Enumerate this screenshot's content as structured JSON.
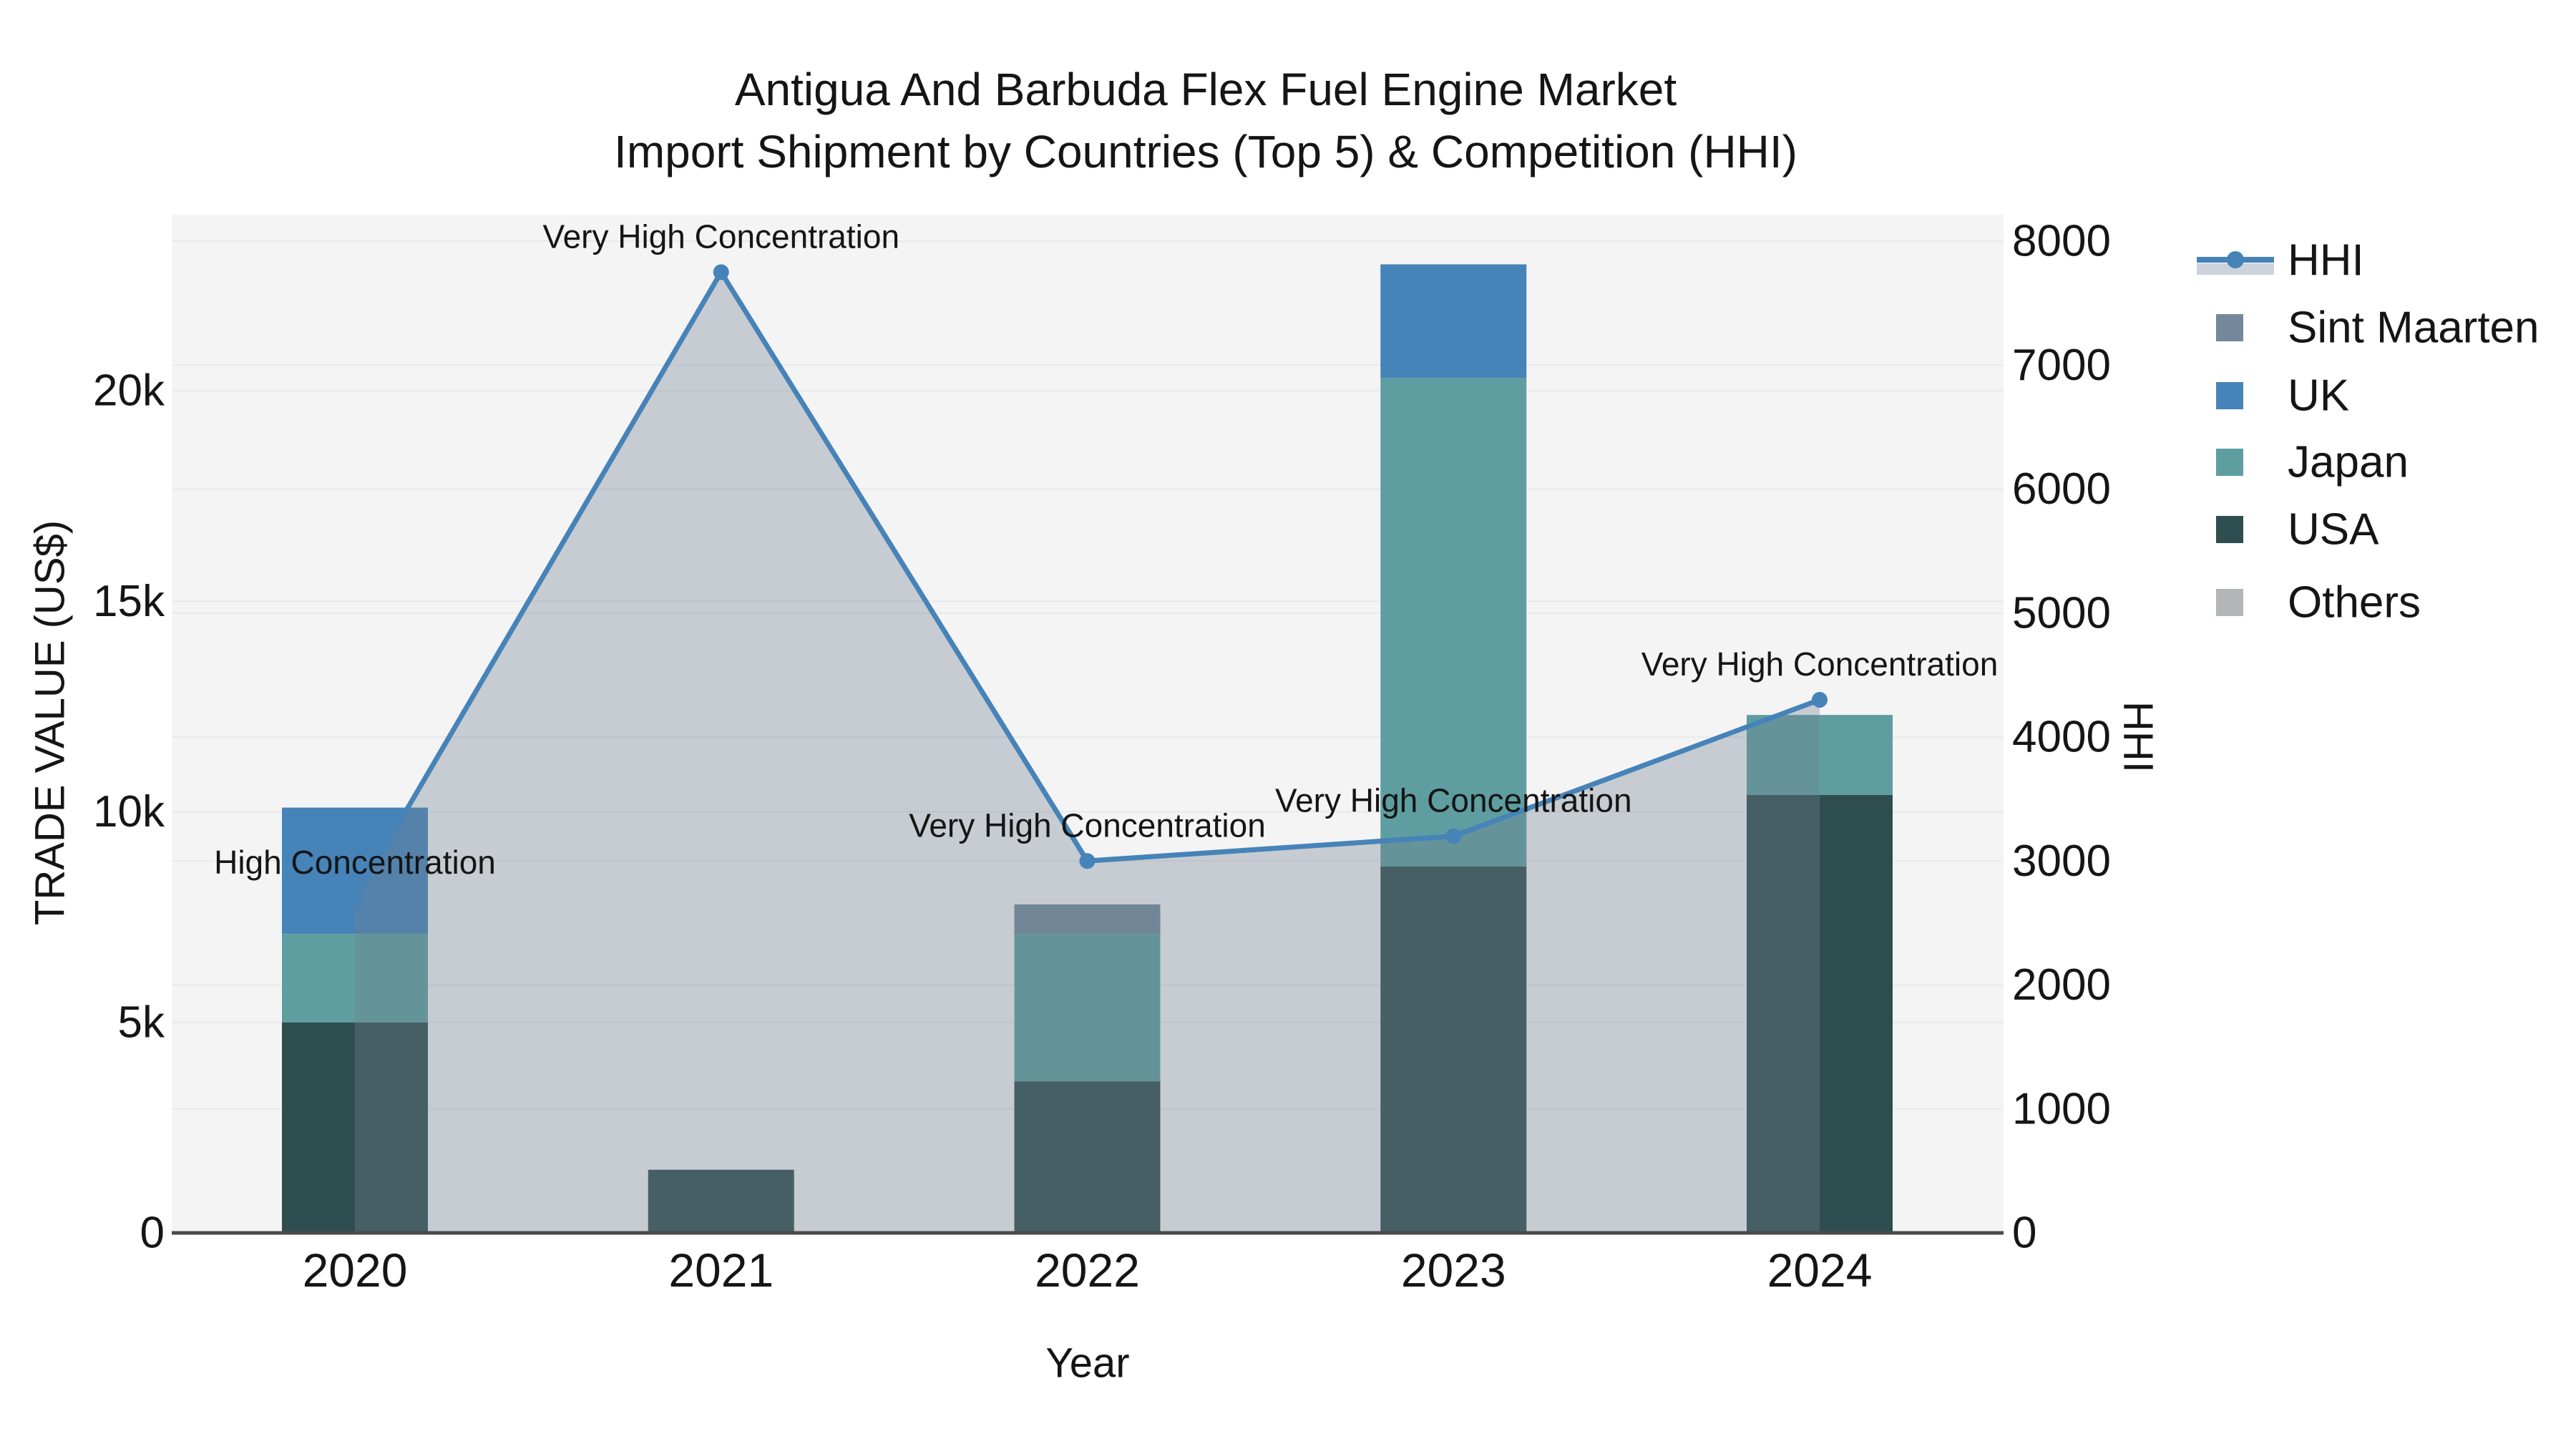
{
  "title": {
    "line1": "Antigua And Barbuda Flex Fuel Engine Market",
    "line2": "Import Shipment by Countries (Top 5) & Competition (HHI)"
  },
  "axes": {
    "x_title": "Year",
    "y_left_title": "TRADE VALUE (US$)",
    "y_right_title": "HHI"
  },
  "legend": {
    "items": [
      {
        "label": "HHI",
        "type": "line",
        "color": "#4683B8",
        "band_color": "#CDD3DC"
      },
      {
        "label": "Sint Maarten",
        "type": "swatch",
        "color": "#74879B"
      },
      {
        "label": "UK",
        "type": "swatch",
        "color": "#4683B8"
      },
      {
        "label": "Japan",
        "type": "swatch",
        "color": "#5F9EA0"
      },
      {
        "label": "USA",
        "type": "swatch",
        "color": "#2E4D4F"
      },
      {
        "label": "Others",
        "type": "swatch",
        "color": "#B2B6B6"
      }
    ]
  },
  "chart_data": {
    "type": "bar",
    "subtype": "stacked-bars-with-dual-axis-line-area",
    "categories": [
      "2020",
      "2021",
      "2022",
      "2023",
      "2024"
    ],
    "bar_series": [
      {
        "name": "USA",
        "color": "#2E4D4F",
        "values": [
          5000,
          1500,
          3600,
          8700,
          10400
        ]
      },
      {
        "name": "Japan",
        "color": "#5F9EA0",
        "values": [
          2100,
          0,
          3500,
          11600,
          1900
        ]
      },
      {
        "name": "UK",
        "color": "#4683B8",
        "values": [
          3000,
          0,
          0,
          2700,
          0
        ]
      },
      {
        "name": "Sint Maarten",
        "color": "#74879B",
        "values": [
          0,
          0,
          700,
          0,
          0
        ]
      },
      {
        "name": "Others",
        "color": "#B2B6B6",
        "values": [
          0,
          0,
          0,
          0,
          0
        ]
      }
    ],
    "line_series": {
      "name": "HHI",
      "color": "#4683B8",
      "area_fill": "rgba(112,128,144,0.35)",
      "values": [
        2700,
        7750,
        3000,
        3200,
        4300
      ]
    },
    "annotations": [
      {
        "category": "2020",
        "text": "High Concentration"
      },
      {
        "category": "2021",
        "text": "Very High Concentration"
      },
      {
        "category": "2022",
        "text": "Very High Concentration"
      },
      {
        "category": "2023",
        "text": "Very High Concentration"
      },
      {
        "category": "2024",
        "text": "Very High Concentration"
      }
    ],
    "left_axis": {
      "title": "TRADE VALUE (US$)",
      "tick_labels": [
        "0",
        "5k",
        "10k",
        "15k",
        "20k"
      ],
      "tick_values": [
        0,
        5000,
        10000,
        15000,
        20000
      ],
      "range": [
        0,
        24000
      ]
    },
    "right_axis": {
      "title": "HHI",
      "tick_labels": [
        "0",
        "1000",
        "2000",
        "3000",
        "4000",
        "5000",
        "6000",
        "7000",
        "8000"
      ],
      "tick_values": [
        0,
        1000,
        2000,
        3000,
        4000,
        5000,
        6000,
        7000,
        8000
      ],
      "range": [
        0,
        8000
      ]
    },
    "xlabel": "Year",
    "grid": true,
    "legend_position": "right",
    "plot_bg": "#F4F4F5",
    "grid_color": "#E9E9EB",
    "axis_line_color": "#4A4A4A"
  }
}
